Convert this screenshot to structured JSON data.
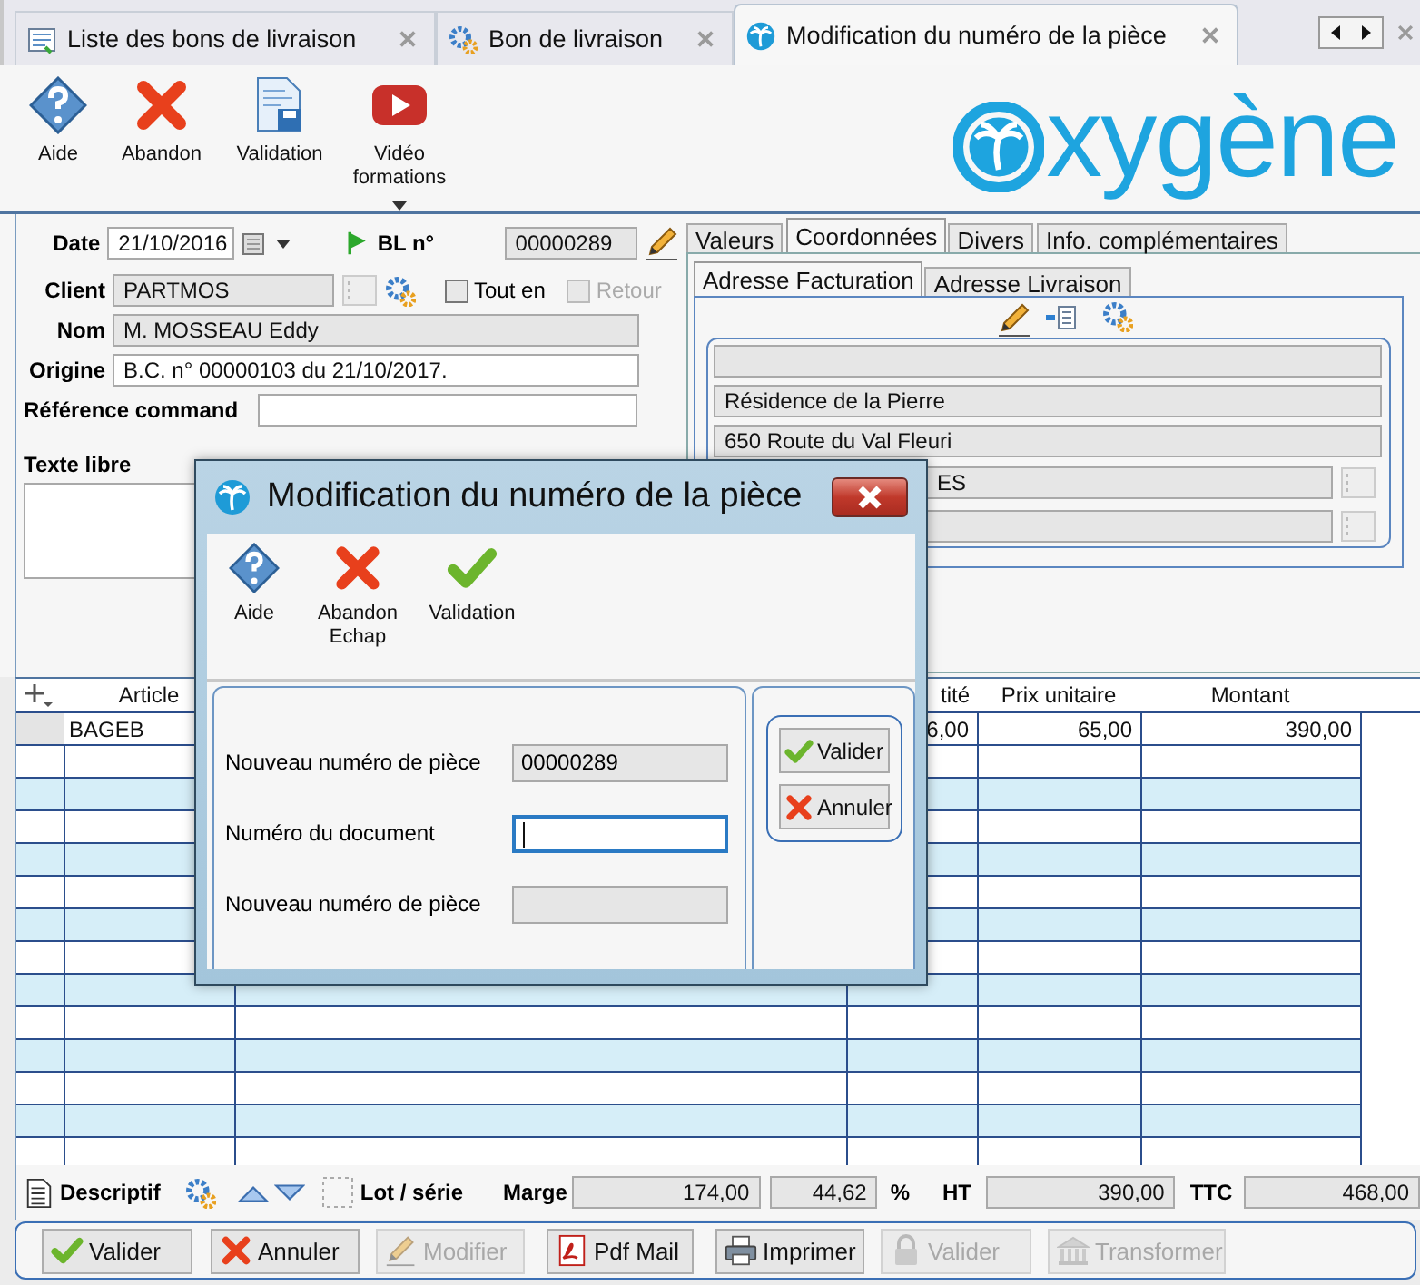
{
  "tabs": [
    {
      "label": "Liste des bons de livraison",
      "selected": false
    },
    {
      "label": "Bon de livraison",
      "selected": false
    },
    {
      "label": "Modification du numéro de la pièce",
      "selected": true
    }
  ],
  "toolbar": [
    {
      "label": "Aide"
    },
    {
      "label": "Abandon"
    },
    {
      "label": "Validation"
    },
    {
      "label": "Vidéo formations"
    }
  ],
  "logo": "xygène",
  "form": {
    "date_label": "Date",
    "date": "21/10/2016",
    "bl_label": "BL n°",
    "bl_number": "00000289",
    "client_label": "Client",
    "client": "PARTMOS",
    "tout_label": "Tout en",
    "tout_checked": false,
    "retour_label": "Retour",
    "retour_checked": false,
    "retour_disabled": true,
    "nom_label": "Nom",
    "nom": "M. MOSSEAU Eddy",
    "origine_label": "Origine",
    "origine": "B.C. n° 00000103 du 21/10/2017.",
    "reference_label": "Référence command",
    "texte_libre_label": "Texte libre"
  },
  "side": {
    "tabs": [
      {
        "label": "Valeurs",
        "selected": false
      },
      {
        "label": "Coordonnées",
        "selected": true
      },
      {
        "label": "Divers",
        "selected": false
      },
      {
        "label": "Info. complémentaires",
        "selected": false
      }
    ],
    "address_tabs": [
      {
        "label": "Adresse Facturation",
        "selected": true
      },
      {
        "label": "Adresse Livraison",
        "selected": false
      }
    ],
    "address_lines": [
      {
        "kind": "wide"
      },
      {
        "kind": "wide",
        "value": "Résidence de la Pierre"
      },
      {
        "kind": "wide",
        "value": "650 Route du Val Fleuri"
      },
      {
        "kind": "short",
        "value": "ES"
      },
      {
        "kind": "short"
      }
    ]
  },
  "grid": {
    "columns": [
      "Article",
      "tité",
      "Prix unitaire",
      "Montant"
    ],
    "rows": [
      {
        "cells": [
          "BAGEB",
          "6,00",
          "65,00",
          "390,00"
        ]
      }
    ]
  },
  "totals": {
    "descriptif": "Descriptif",
    "lot": "Lot / série",
    "marge_label": "Marge",
    "marge": "174,00",
    "marge_pct": "44,62",
    "pct_sign": "%",
    "ht_label": "HT",
    "ht": "390,00",
    "ttc_label": "TTC",
    "ttc": "468,00"
  },
  "buttons": [
    {
      "label": "Valider",
      "disabled": false
    },
    {
      "label": "Annuler",
      "disabled": false
    },
    {
      "label": "Modifier",
      "disabled": true
    },
    {
      "label": "Pdf Mail",
      "disabled": false
    },
    {
      "label": "Imprimer",
      "disabled": false
    },
    {
      "label": "Valider",
      "disabled": true
    },
    {
      "label": "Transformer",
      "disabled": true
    }
  ],
  "dialog": {
    "title": "Modification du numéro de la pièce",
    "toolbar": [
      {
        "label": "Aide"
      },
      {
        "label": "Abandon",
        "shortcut": "Echap"
      },
      {
        "label": "Validation"
      }
    ],
    "fields": [
      {
        "label": "Nouveau numéro de pièce",
        "value": "00000289",
        "disabled": true,
        "focused": false
      },
      {
        "label": "Numéro du document",
        "disabled": false,
        "focused": true
      },
      {
        "label": "Nouveau numéro de pièce",
        "disabled": true,
        "focused": false
      }
    ],
    "buttons": [
      "Valider",
      "Annuler"
    ]
  }
}
